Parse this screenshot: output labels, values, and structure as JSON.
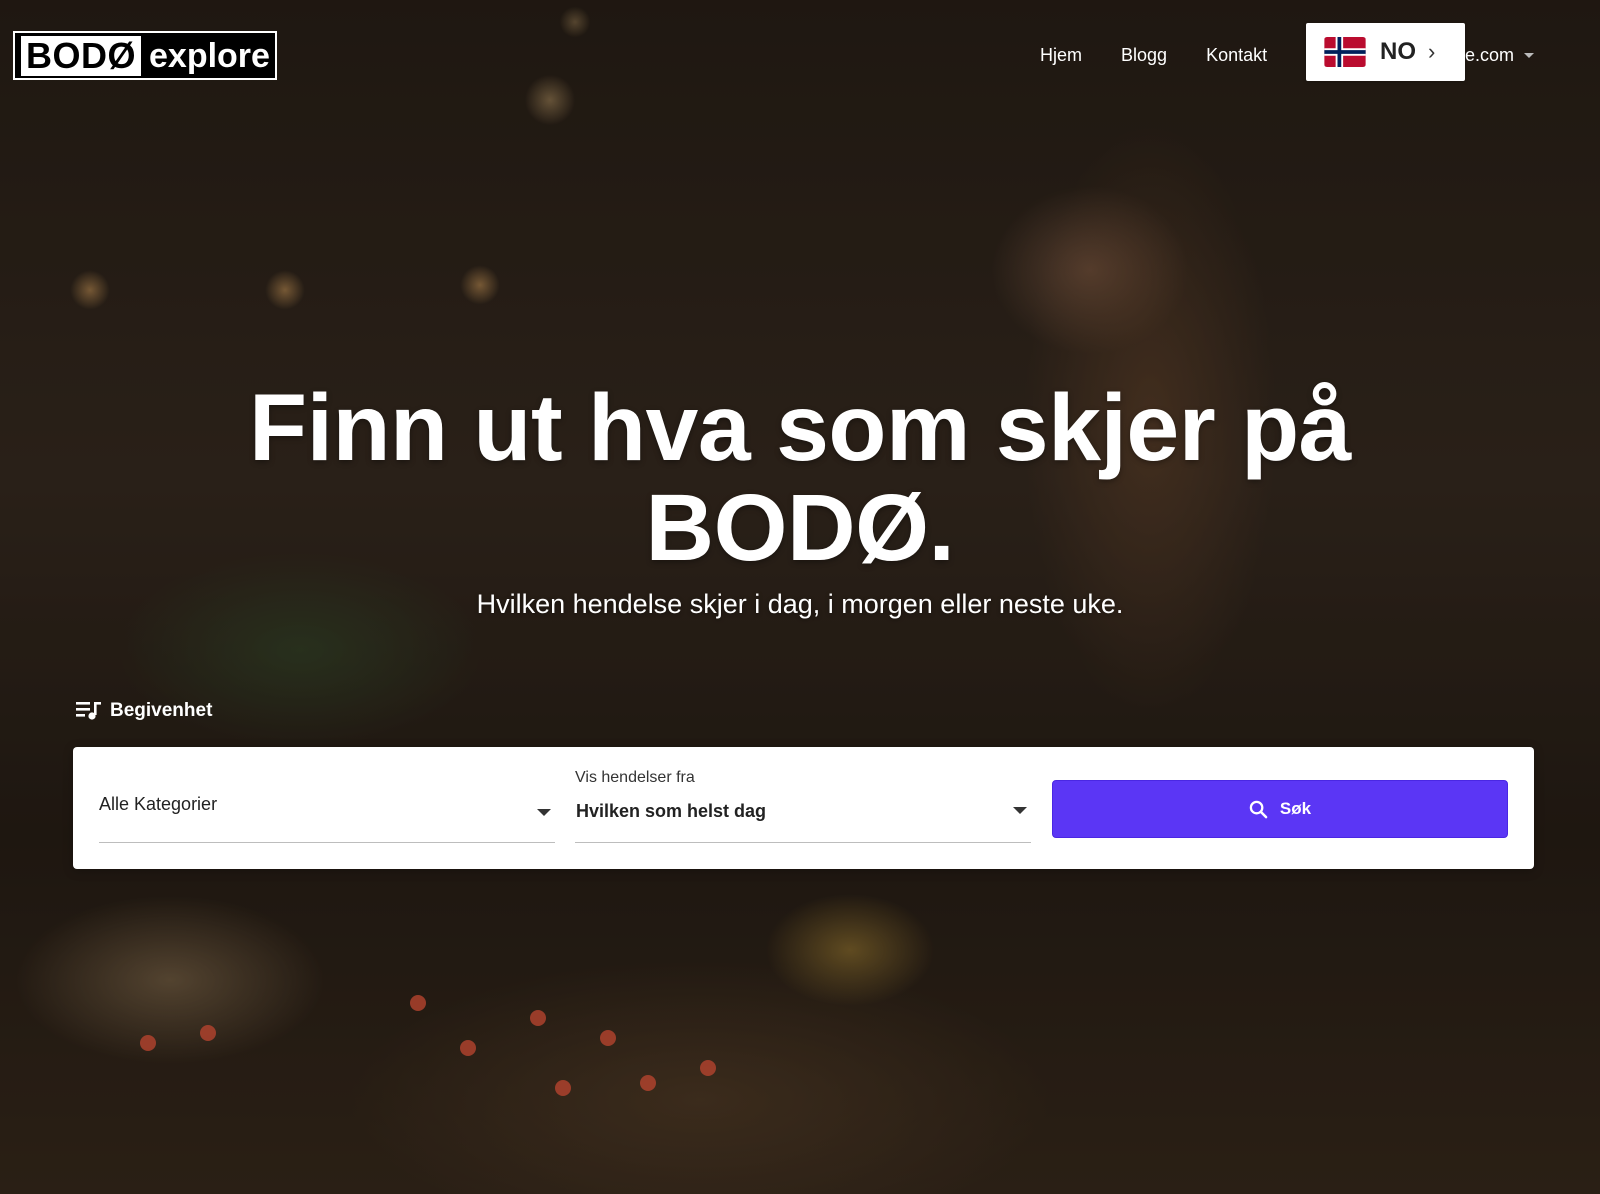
{
  "brand": {
    "logo_part1": "BODØ",
    "logo_part2": "explore"
  },
  "nav": {
    "items": [
      {
        "label": "Hjem"
      },
      {
        "label": "Blogg"
      },
      {
        "label": "Kontakt"
      }
    ],
    "account_partial": "ome.com"
  },
  "language": {
    "code": "NO",
    "flag": "norway-flag-icon"
  },
  "hero": {
    "title_line1": "Finn ut hva som skjer på",
    "title_line2": "BODØ.",
    "subtitle": "Hvilken hendelse skjer i dag, i morgen eller neste uke."
  },
  "search": {
    "tab_label": "Begivenhet",
    "category": {
      "value": "Alle Kategorier"
    },
    "date": {
      "label": "Vis hendelser fra",
      "value": "Hvilken som helst dag"
    },
    "button_label": "Søk",
    "button_icon": "search-icon"
  },
  "colors": {
    "accent": "#5b36f5",
    "panel_bg": "#ffffff"
  }
}
